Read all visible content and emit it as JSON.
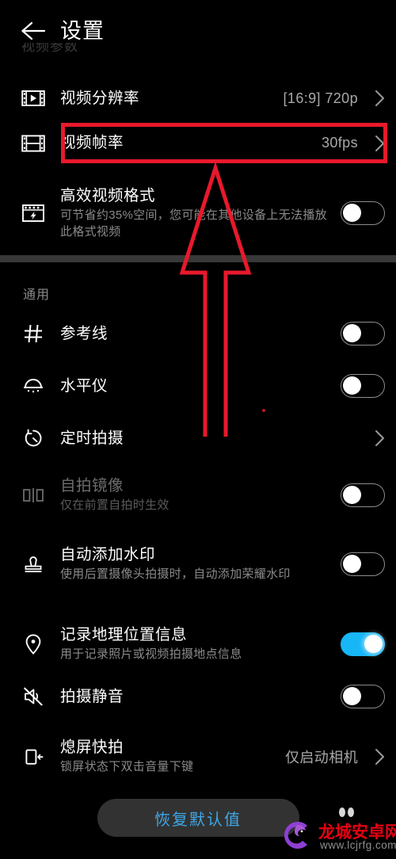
{
  "header": {
    "back_icon": "back-arrow-icon",
    "title": "设置",
    "ghost_label": "视频参数"
  },
  "sections": [
    {
      "id": "video",
      "label": "",
      "rows": [
        {
          "id": "video-resolution",
          "icon": "video-resolution-icon",
          "title": "视频分辨率",
          "sub": "",
          "value": "[16:9] 720p",
          "control": "chevron",
          "disabled": false
        },
        {
          "id": "video-framerate",
          "icon": "video-framerate-icon",
          "title": "视频帧率",
          "sub": "",
          "value": "30fps",
          "control": "chevron",
          "disabled": false,
          "highlighted": true
        },
        {
          "id": "efficient-video-format",
          "icon": "efficient-video-icon",
          "title": "高效视频格式",
          "sub": "可节省约35%空间，您可能在其他设备上无法播放此格式视频",
          "value": "",
          "control": "toggle",
          "toggle_on": false,
          "disabled": false
        }
      ]
    },
    {
      "id": "general",
      "label": "通用",
      "rows": [
        {
          "id": "grid-lines",
          "icon": "grid-icon",
          "title": "参考线",
          "sub": "",
          "value": "",
          "control": "toggle",
          "toggle_on": false,
          "disabled": false
        },
        {
          "id": "level",
          "icon": "level-icon",
          "title": "水平仪",
          "sub": "",
          "value": "",
          "control": "toggle",
          "toggle_on": false,
          "disabled": false
        },
        {
          "id": "timer-shooting",
          "icon": "timer-icon",
          "title": "定时拍摄",
          "sub": "",
          "value": "",
          "control": "chevron",
          "disabled": false
        },
        {
          "id": "selfie-mirror",
          "icon": "mirror-icon",
          "title": "自拍镜像",
          "sub": "仅在前置自拍时生效",
          "value": "",
          "control": "toggle",
          "toggle_on": false,
          "disabled": true
        },
        {
          "id": "auto-watermark",
          "icon": "stamp-icon",
          "title": "自动添加水印",
          "sub": "使用后置摄像头拍摄时，自动添加荣耀水印",
          "value": "",
          "control": "toggle",
          "toggle_on": false,
          "disabled": false
        },
        {
          "id": "record-location",
          "icon": "location-pin-icon",
          "title": "记录地理位置信息",
          "sub": "用于记录照片或视频拍摄地点信息",
          "value": "",
          "control": "toggle",
          "toggle_on": true,
          "disabled": false
        },
        {
          "id": "shutter-mute",
          "icon": "speaker-mute-icon",
          "title": "拍摄静音",
          "sub": "",
          "value": "",
          "control": "toggle",
          "toggle_on": false,
          "disabled": false
        },
        {
          "id": "quick-snapshot",
          "icon": "phone-arrow-icon",
          "title": "熄屏快拍",
          "sub": "锁屏状态下双击音量下键",
          "value": "仅启动相机",
          "control": "chevron",
          "disabled": false
        }
      ]
    }
  ],
  "footer": {
    "reset_label": "恢复默认值"
  },
  "annotations": {
    "highlight_color": "#e8192c",
    "arrow_color": "#e8192c",
    "arrow_name": "red-up-arrow-annotation",
    "box_name": "red-highlight-box-annotation"
  },
  "watermark": {
    "site_name": "龙城安卓网",
    "url": "www.lcjrfg.com",
    "logo_color": "#8e3fd4",
    "text_color": "#e60012"
  },
  "colors": {
    "background": "#000000",
    "toggle_on": "#17b6f7",
    "divider": "#383838",
    "reset_text": "#3ea8e8"
  }
}
